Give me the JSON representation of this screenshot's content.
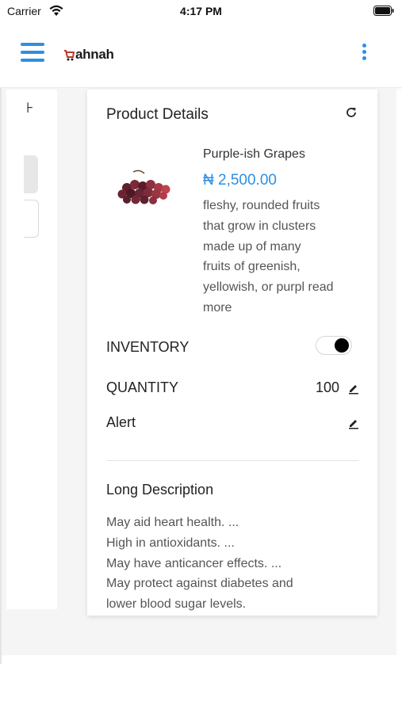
{
  "status_bar": {
    "carrier": "Carrier",
    "time": "4:17 PM"
  },
  "app_bar": {
    "logo_text": "ahnah",
    "menu_icon": "hamburger-icon",
    "more_icon": "more-vertical-icon"
  },
  "side_panel": {
    "glyph": "⊦"
  },
  "card": {
    "title": "Product Details",
    "refresh_icon": "refresh-icon",
    "product": {
      "name": "Purple-ish Grapes",
      "price": "₦ 2,500.00",
      "description_lines": [
        "fleshy, rounded fruits",
        "that grow in clusters",
        "made up of many",
        "fruits of greenish,",
        "yellowish, or purpl read",
        "more"
      ]
    },
    "inventory": {
      "label": "INVENTORY",
      "enabled": true
    },
    "quantity": {
      "label": "QUANTITY",
      "value": "100"
    },
    "alert": {
      "label": "Alert"
    },
    "long_description": {
      "title": "Long Description",
      "lines": [
        "May aid heart health. ...",
        "High in antioxidants. ...",
        "May have anticancer effects. ...",
        "May protect against diabetes and",
        "lower blood sugar levels."
      ]
    }
  },
  "colors": {
    "accent": "#2d8fe2",
    "text": "#222222",
    "muted": "#555555"
  }
}
